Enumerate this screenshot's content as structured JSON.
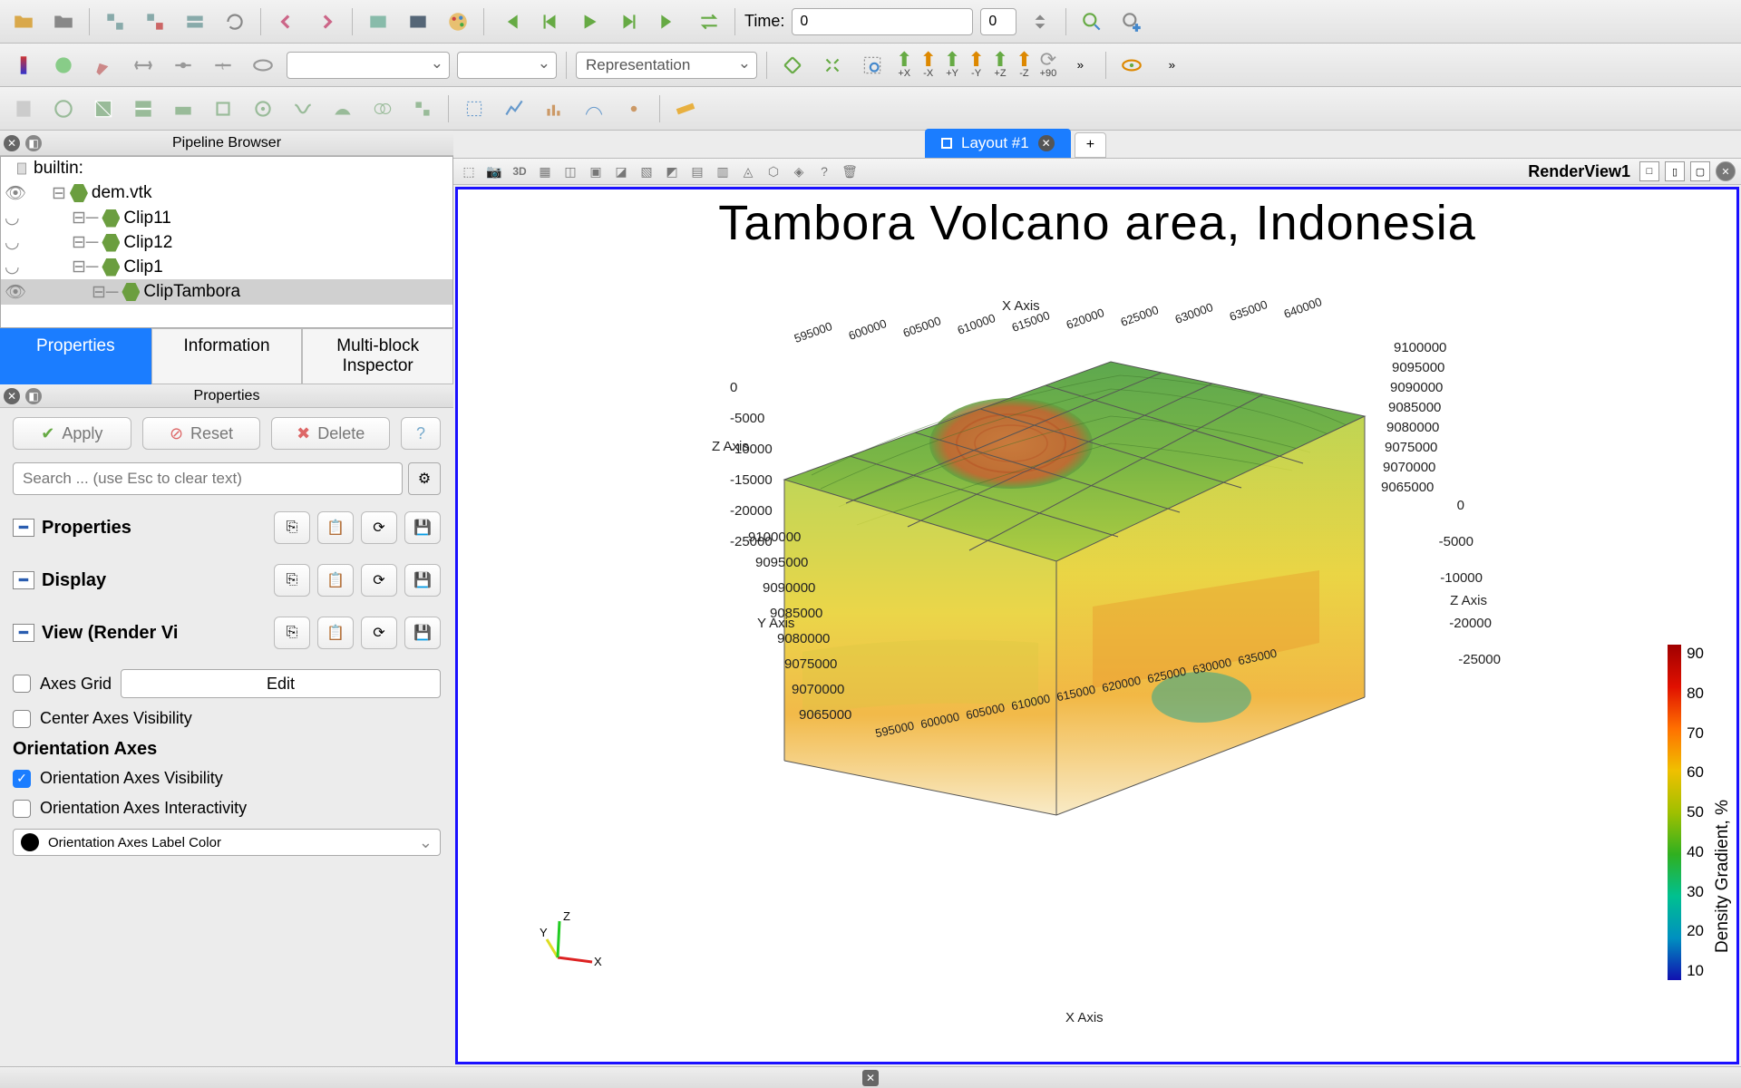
{
  "toolbar": {
    "time_label": "Time:",
    "time_value": "0",
    "time_index": "0",
    "representation": "Representation",
    "axis_buttons": [
      "+X",
      "-X",
      "+Y",
      "-Y",
      "+Z",
      "-Z"
    ],
    "rotate90": "+90"
  },
  "pipeline": {
    "title": "Pipeline Browser",
    "root": "builtin:",
    "items": [
      {
        "label": "dem.vtk",
        "indent": 1,
        "eye": true
      },
      {
        "label": "Clip11",
        "indent": 2,
        "eye": false
      },
      {
        "label": "Clip12",
        "indent": 2,
        "eye": false
      },
      {
        "label": "Clip1",
        "indent": 2,
        "eye": false
      },
      {
        "label": "ClipTambora",
        "indent": 3,
        "eye": true,
        "selected": true
      }
    ]
  },
  "tabs": {
    "properties": "Properties",
    "information": "Information",
    "mbi": "Multi-block Inspector"
  },
  "props": {
    "header": "Properties",
    "apply": "Apply",
    "reset": "Reset",
    "delete": "Delete",
    "search_placeholder": "Search ... (use Esc to clear text)",
    "sections": {
      "properties": "Properties",
      "display": "Display",
      "view": "View (Render Vi"
    },
    "axes_grid": "Axes Grid",
    "edit": "Edit",
    "center_axes": "Center Axes Visibility",
    "ori_head": "Orientation Axes",
    "ori_vis": "Orientation Axes Visibility",
    "ori_int": "Orientation Axes Interactivity",
    "ori_color": "Orientation Axes Label Color"
  },
  "layout": {
    "tab": "Layout #1",
    "add": "+",
    "view_name": "RenderView1"
  },
  "render": {
    "title": "Tambora Volcano area, Indonesia",
    "x_axis": "X Axis",
    "y_axis": "Y Axis",
    "z_axis": "Z Axis",
    "x_ticks": [
      "595000",
      "600000",
      "605000",
      "610000",
      "615000",
      "620000",
      "625000",
      "630000",
      "635000",
      "640000"
    ],
    "y_ticks": [
      "9065000",
      "9070000",
      "9075000",
      "9080000",
      "9085000",
      "9090000",
      "9095000",
      "9100000"
    ],
    "z_ticks": [
      "0",
      "-5000",
      "-10000",
      "-15000",
      "-20000",
      "-25000"
    ],
    "colorbar_title": "Density Gradient, %",
    "colorbar_ticks": [
      "90",
      "80",
      "70",
      "60",
      "50",
      "40",
      "30",
      "20",
      "10"
    ]
  },
  "chart_data": {
    "type": "volume",
    "title": "Tambora Volcano area, Indonesia",
    "xlabel": "X Axis",
    "ylabel": "Y Axis",
    "zlabel": "Z Axis",
    "x_range": [
      595000,
      640000
    ],
    "y_range": [
      9065000,
      9100000
    ],
    "z_range": [
      -25000,
      0
    ],
    "colorbar": {
      "label": "Density Gradient, %",
      "range": [
        10,
        90
      ]
    }
  }
}
